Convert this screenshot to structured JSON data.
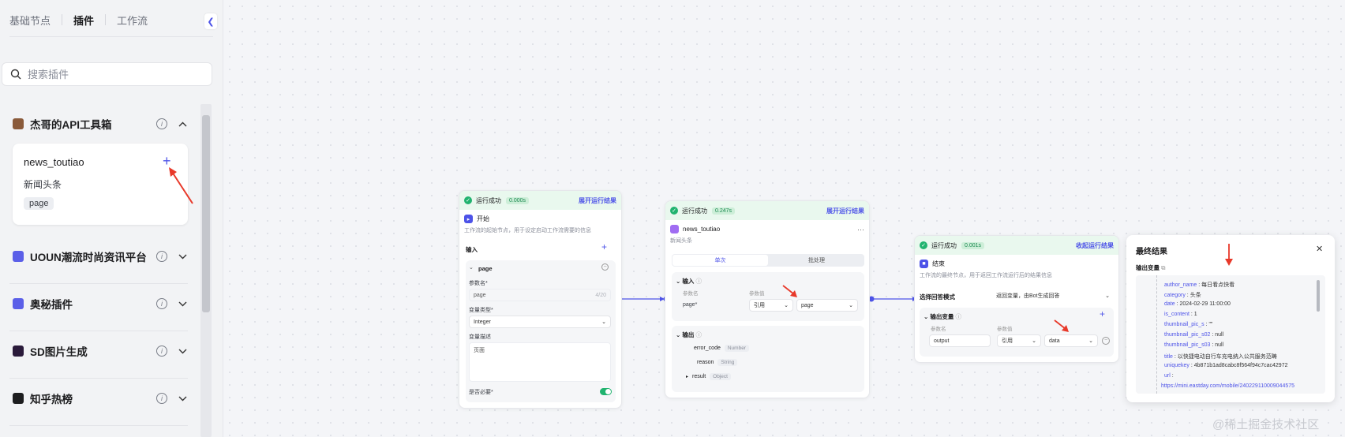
{
  "sidebar": {
    "tabs": [
      "基础节点",
      "插件",
      "工作流"
    ],
    "active_tab": "插件",
    "collapse_icon": "chevron-left-icon",
    "search": {
      "placeholder": "搜索插件",
      "value": ""
    },
    "groups": [
      {
        "title": "杰哥的API工具箱",
        "icon_color": "#8a5a3a",
        "expanded": true,
        "tools": [
          {
            "name": "news_toutiao",
            "desc": "新闻头条",
            "param": "page"
          }
        ]
      },
      {
        "title": "UOUN潮流时尚资讯平台",
        "icon_color": "#5b5fe8",
        "expanded": false
      },
      {
        "title": "奥秘插件",
        "icon_color": "#5b5fe8",
        "expanded": false
      },
      {
        "title": "SD图片生成",
        "icon_color": "#2a1a3a",
        "expanded": false
      },
      {
        "title": "知乎热榜",
        "icon_color": "#1d1d1f",
        "expanded": false
      }
    ]
  },
  "nodes": {
    "start": {
      "status": "运行成功",
      "time": "0.000s",
      "link": "展开运行结果",
      "title": "开始",
      "desc": "工作流的起始节点，用于设定启动工作流需要的信息",
      "input_label": "输入",
      "param_name": "page",
      "param_name_label": "参数名*",
      "param_name_value": "page",
      "param_name_count": "4/20",
      "var_type_label": "变量类型*",
      "var_type_value": "Integer",
      "var_desc_label": "变量描述",
      "var_desc_value": "页面",
      "required_label": "是否必要*"
    },
    "plugin": {
      "status": "运行成功",
      "time": "0.247s",
      "link": "展开运行结果",
      "title": "news_toutiao",
      "desc": "新闻头条",
      "tab_single": "单次",
      "tab_batch": "批处理",
      "input_label": "输入",
      "col_param": "参数名",
      "col_value": "参数值",
      "param": "page*",
      "ref": "引用",
      "ref_value": "page",
      "output_label": "输出",
      "outputs": [
        {
          "name": "error_code",
          "type": "Number"
        },
        {
          "name": "reason",
          "type": "String"
        },
        {
          "name": "result",
          "type": "Object"
        }
      ],
      "more_icon": "more-icon"
    },
    "end": {
      "status": "运行成功",
      "time": "0.001s",
      "link": "收起运行结果",
      "title": "结束",
      "desc": "工作流的最终节点，用于返回工作流运行后的结果信息",
      "mode_label": "选择回答模式",
      "mode_value": "返回变量，由Bot生成回答",
      "output_var_label": "输出变量",
      "col_param": "参数名",
      "col_value": "参数值",
      "var_name": "output",
      "ref": "引用",
      "ref_value": "data"
    }
  },
  "result": {
    "title": "最终结果",
    "sub": "输出变量",
    "lines": [
      {
        "k": "author_name",
        "v": "每日看点快看"
      },
      {
        "k": "category",
        "v": "头条"
      },
      {
        "k": "date",
        "v": "2024-02-29 11:00:00"
      },
      {
        "k": "is_content",
        "v": "1"
      },
      {
        "k": "thumbnail_pic_s",
        "v": "\"\""
      },
      {
        "k": "thumbnail_pic_s02",
        "v": "null"
      },
      {
        "k": "thumbnail_pic_s03",
        "v": "null"
      },
      {
        "k": "title",
        "v": "以快捷电动自行车充电纳入公共服务范畴"
      },
      {
        "k": "uniquekey",
        "v": "4b871b1ad8cabc8f564f94c7cac42972"
      },
      {
        "k": "url",
        "v": ""
      }
    ],
    "url_value": "https://mini.eastday.com/mobile/240229110009044575"
  },
  "watermark": "@稀土掘金技术社区",
  "colors": {
    "accent": "#4d53e8",
    "success": "#21b36f",
    "annotation": "#e8392a"
  }
}
